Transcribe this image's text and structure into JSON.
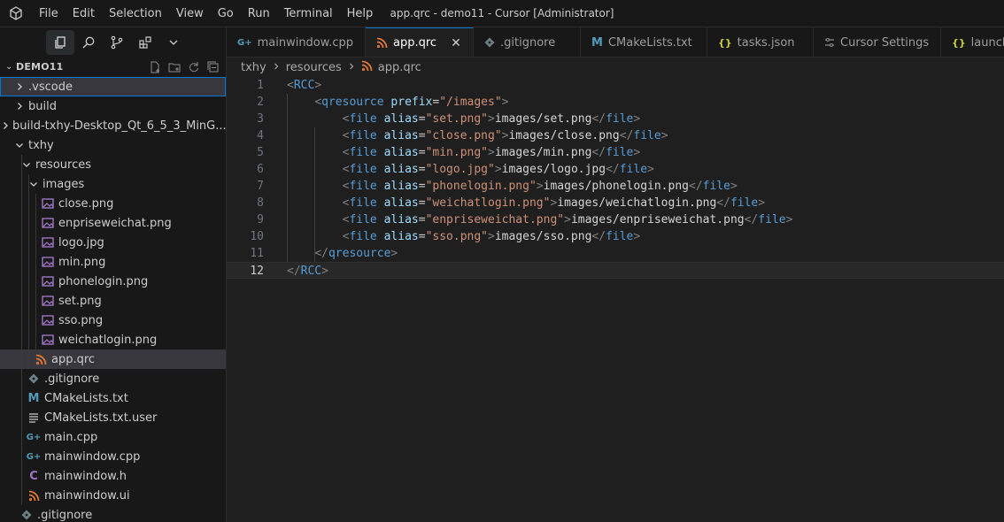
{
  "window": {
    "title": "app.qrc - demo11 - Cursor [Administrator]"
  },
  "menu": [
    "File",
    "Edit",
    "Selection",
    "View",
    "Go",
    "Run",
    "Terminal",
    "Help"
  ],
  "activity": [
    {
      "name": "explorer-icon"
    },
    {
      "name": "search-icon"
    },
    {
      "name": "source-control-icon"
    },
    {
      "name": "extensions-icon"
    },
    {
      "name": "chevron-down-icon"
    }
  ],
  "explorer": {
    "root": "DEMO11",
    "items": [
      {
        "label": ".vscode",
        "type": "folder",
        "depth": 0,
        "open": false,
        "state": "focused"
      },
      {
        "label": "build",
        "type": "folder",
        "depth": 0,
        "open": false
      },
      {
        "label": "build-txhy-Desktop_Qt_6_5_3_MinG...",
        "type": "folder",
        "depth": 0,
        "open": false
      },
      {
        "label": "txhy",
        "type": "folder",
        "depth": 0,
        "open": true
      },
      {
        "label": "resources",
        "type": "folder",
        "depth": 1,
        "open": true
      },
      {
        "label": "images",
        "type": "folder",
        "depth": 2,
        "open": true
      },
      {
        "label": "close.png",
        "type": "image",
        "depth": 3
      },
      {
        "label": "enpriseweichat.png",
        "type": "image",
        "depth": 3
      },
      {
        "label": "logo.jpg",
        "type": "image",
        "depth": 3
      },
      {
        "label": "min.png",
        "type": "image",
        "depth": 3
      },
      {
        "label": "phonelogin.png",
        "type": "image",
        "depth": 3
      },
      {
        "label": "set.png",
        "type": "image",
        "depth": 3
      },
      {
        "label": "sso.png",
        "type": "image",
        "depth": 3
      },
      {
        "label": "weichatlogin.png",
        "type": "image",
        "depth": 3
      },
      {
        "label": "app.qrc",
        "type": "rss",
        "depth": 2,
        "state": "selected"
      },
      {
        "label": ".gitignore",
        "type": "git",
        "depth": 1
      },
      {
        "label": "CMakeLists.txt",
        "type": "cmake",
        "depth": 1
      },
      {
        "label": "CMakeLists.txt.user",
        "type": "text",
        "depth": 1
      },
      {
        "label": "main.cpp",
        "type": "cpp",
        "depth": 1
      },
      {
        "label": "mainwindow.cpp",
        "type": "cpp",
        "depth": 1
      },
      {
        "label": "mainwindow.h",
        "type": "header",
        "depth": 1
      },
      {
        "label": "mainwindow.ui",
        "type": "rss",
        "depth": 1
      },
      {
        "label": ".gitignore",
        "type": "git",
        "depth": 0
      }
    ]
  },
  "tabs": [
    {
      "label": "mainwindow.cpp",
      "icon": "cpp"
    },
    {
      "label": "app.qrc",
      "icon": "rss",
      "active": true,
      "close": "✕"
    },
    {
      "label": ".gitignore",
      "icon": "git"
    },
    {
      "label": "CMakeLists.txt",
      "icon": "cmake"
    },
    {
      "label": "tasks.json",
      "icon": "json"
    },
    {
      "label": "Cursor Settings",
      "icon": "settings"
    },
    {
      "label": "launch",
      "icon": "json"
    }
  ],
  "breadcrumb": [
    "txhy",
    "resources",
    "app.qrc"
  ],
  "editor": {
    "current_line": 12,
    "lines": [
      {
        "n": "1",
        "indent": 0,
        "kind": "open",
        "tag": "RCC"
      },
      {
        "n": "2",
        "indent": 1,
        "kind": "open-attr",
        "tag": "qresource",
        "attr": "prefix",
        "value": "\"/images\""
      },
      {
        "n": "3",
        "indent": 2,
        "kind": "file",
        "alias": "\"set.png\"",
        "text": "images/set.png"
      },
      {
        "n": "4",
        "indent": 2,
        "kind": "file",
        "alias": "\"close.png\"",
        "text": "images/close.png"
      },
      {
        "n": "5",
        "indent": 2,
        "kind": "file",
        "alias": "\"min.png\"",
        "text": "images/min.png"
      },
      {
        "n": "6",
        "indent": 2,
        "kind": "file",
        "alias": "\"logo.jpg\"",
        "text": "images/logo.jpg"
      },
      {
        "n": "7",
        "indent": 2,
        "kind": "file",
        "alias": "\"phonelogin.png\"",
        "text": "images/phonelogin.png"
      },
      {
        "n": "8",
        "indent": 2,
        "kind": "file",
        "alias": "\"weichatlogin.png\"",
        "text": "images/weichatlogin.png"
      },
      {
        "n": "9",
        "indent": 2,
        "kind": "file",
        "alias": "\"enpriseweichat.png\"",
        "text": "images/enpriseweichat.png"
      },
      {
        "n": "10",
        "indent": 2,
        "kind": "file",
        "alias": "\"sso.png\"",
        "text": "images/sso.png"
      },
      {
        "n": "11",
        "indent": 1,
        "kind": "close",
        "tag": "qresource"
      },
      {
        "n": "12",
        "indent": 0,
        "kind": "close",
        "tag": "RCC"
      }
    ]
  },
  "colors": {
    "accent": "#0078d4",
    "image_icon": "#a074c4",
    "rss_icon": "#e37933",
    "cpp_icon": "#519aba",
    "cmake_icon": "#519aba",
    "header_icon": "#a074c4",
    "json_icon": "#cbcb41",
    "git_icon": "#6d8086",
    "text_icon": "#cccccc"
  }
}
